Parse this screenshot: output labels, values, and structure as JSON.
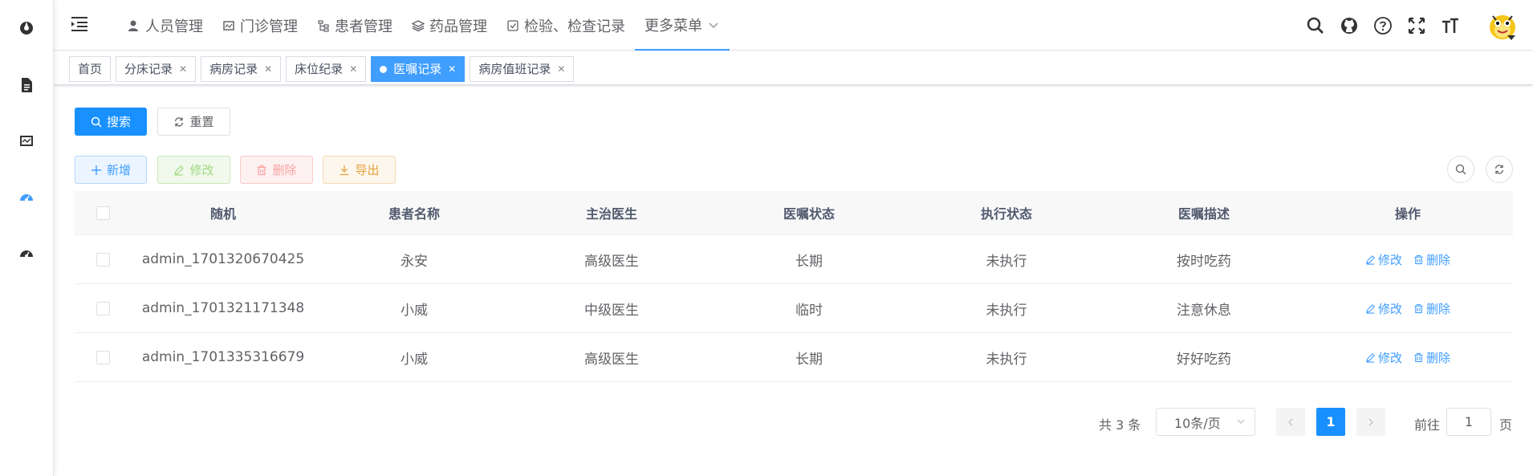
{
  "nav": {
    "menu": [
      {
        "label": "人员管理",
        "icon": "person-icon"
      },
      {
        "label": "门诊管理",
        "icon": "clinic-icon"
      },
      {
        "label": "患者管理",
        "icon": "tree-icon"
      },
      {
        "label": "药品管理",
        "icon": "layers-icon"
      },
      {
        "label": "检验、检查记录",
        "icon": "checkbox-icon"
      }
    ],
    "more_label": "更多菜单"
  },
  "tags": [
    {
      "label": "首页",
      "closable": false,
      "active": false
    },
    {
      "label": "分床记录",
      "closable": true,
      "active": false
    },
    {
      "label": "病房记录",
      "closable": true,
      "active": false
    },
    {
      "label": "床位纪录",
      "closable": true,
      "active": false
    },
    {
      "label": "医嘱记录",
      "closable": true,
      "active": true
    },
    {
      "label": "病房值班记录",
      "closable": true,
      "active": false
    }
  ],
  "search": {
    "search_label": "搜索",
    "reset_label": "重置"
  },
  "toolbar": {
    "add_label": "新增",
    "edit_label": "修改",
    "delete_label": "删除",
    "export_label": "导出"
  },
  "table": {
    "headers": [
      "随机",
      "患者名称",
      "主治医生",
      "医嘱状态",
      "执行状态",
      "医嘱描述",
      "操作"
    ],
    "rows": [
      {
        "id": "admin_1701320670425",
        "patient": "永安",
        "doctor": "高级医生",
        "order_status": "长期",
        "exec_status": "未执行",
        "desc": "按时吃药"
      },
      {
        "id": "admin_1701321171348",
        "patient": "小威",
        "doctor": "中级医生",
        "order_status": "临时",
        "exec_status": "未执行",
        "desc": "注意休息"
      },
      {
        "id": "admin_1701335316679",
        "patient": "小威",
        "doctor": "高级医生",
        "order_status": "长期",
        "exec_status": "未执行",
        "desc": "好好吃药"
      }
    ],
    "op_edit": "修改",
    "op_delete": "删除"
  },
  "pagination": {
    "total_text": "共 3 条",
    "page_size": "10条/页",
    "current_page": "1",
    "goto_prefix": "前往",
    "goto_value": "1",
    "goto_suffix": "页"
  },
  "colors": {
    "primary": "#1890ff",
    "link": "#409eff"
  }
}
